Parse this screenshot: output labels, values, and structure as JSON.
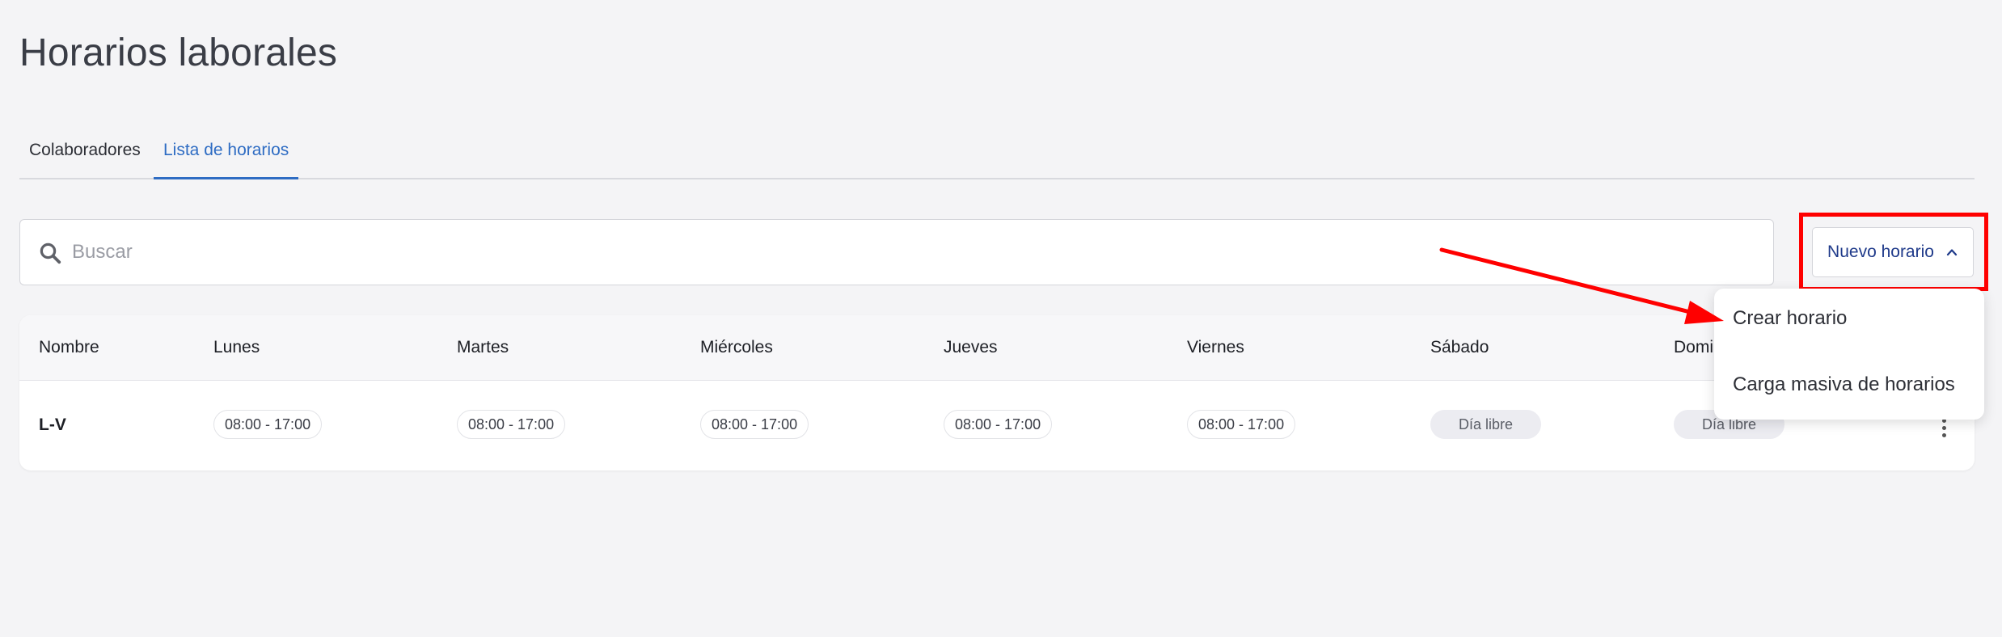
{
  "page": {
    "title": "Horarios laborales"
  },
  "tabs": [
    {
      "label": "Colaboradores",
      "active": false
    },
    {
      "label": "Lista de horarios",
      "active": true
    }
  ],
  "search": {
    "placeholder": "Buscar",
    "value": ""
  },
  "toolbar": {
    "new_schedule_label": "Nuevo horario"
  },
  "dropdown": {
    "items": [
      {
        "label": "Crear horario"
      },
      {
        "label": "Carga masiva de horarios"
      }
    ]
  },
  "table": {
    "columns": [
      "Nombre",
      "Lunes",
      "Martes",
      "Miércoles",
      "Jueves",
      "Viernes",
      "Sábado",
      "Domi"
    ],
    "rows": [
      {
        "name": "L-V",
        "cells": [
          "08:00 - 17:00",
          "08:00 - 17:00",
          "08:00 - 17:00",
          "08:00 - 17:00",
          "08:00 - 17:00",
          "Día libre",
          "Día libre"
        ]
      }
    ]
  },
  "colors": {
    "accent": "#2e6cc3",
    "button_text": "#1f3a8a",
    "annotation": "#ff0000"
  }
}
